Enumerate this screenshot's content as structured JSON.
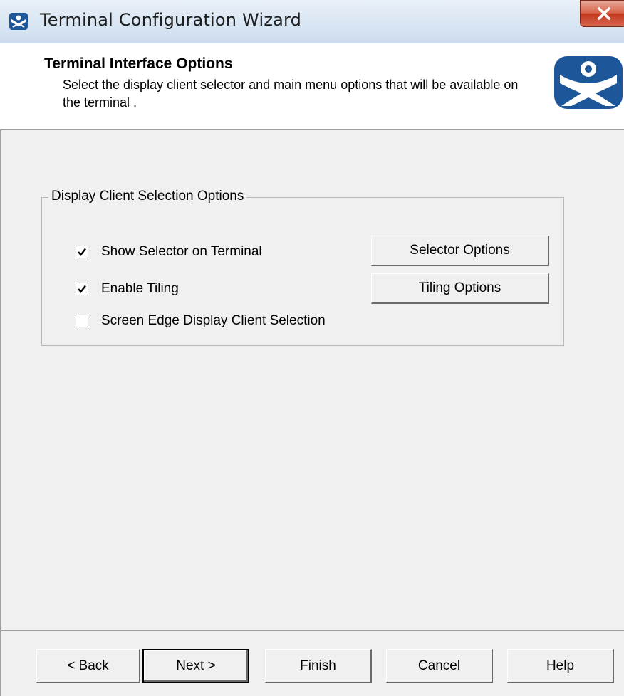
{
  "window": {
    "title": "Terminal Configuration Wizard",
    "app_icon": "thinmanager-icon",
    "close_icon": "close-icon"
  },
  "header": {
    "title": "Terminal Interface Options",
    "description": "Select the display client selector and main menu options that will be available on the terminal .",
    "logo": "thinmanager-logo-icon"
  },
  "group": {
    "title": "Display Client Selection Options",
    "options": [
      {
        "label": "Show Selector on Terminal",
        "checked": true
      },
      {
        "label": "Enable Tiling",
        "checked": true
      },
      {
        "label": "Screen Edge Display Client Selection",
        "checked": false
      }
    ],
    "buttons": {
      "selector_options": "Selector Options",
      "tiling_options": "Tiling Options"
    }
  },
  "footer": {
    "back": "< Back",
    "next": "Next >",
    "finish": "Finish",
    "cancel": "Cancel",
    "help": "Help"
  },
  "colors": {
    "window_bg": "#f0f0f0",
    "header_bg": "#ffffff",
    "logo_blue": "#1e5799",
    "close_red": "#c4391f"
  }
}
